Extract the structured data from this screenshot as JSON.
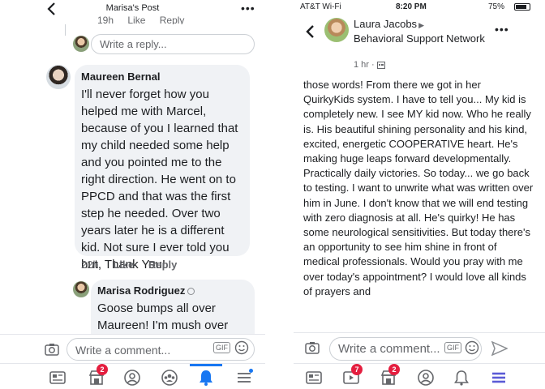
{
  "left": {
    "header": {
      "title": "Marisa's Post"
    },
    "cut_row": {
      "time": "19h",
      "like": "Like",
      "reply": "Reply"
    },
    "reply_placeholder": "Write a reply...",
    "comment1": {
      "author": "Maureen Bernal",
      "text": "I'll never forget how you helped me with Marcel, because of you I learned that my child needed some help and you pointed me to the right direction. He went on to PPCD and that was the first step he needed. Over two years later he is a different kid. Not sure I ever told you but, Thank You!",
      "time": "22h",
      "like": "Like",
      "reply": "Reply"
    },
    "comment2": {
      "author": "Marisa Rodriguez",
      "text": "Goose bumps all over Maureen!  I'm mush over"
    },
    "composer": {
      "placeholder": "Write a comment...",
      "gif": "GIF"
    },
    "tabs": {
      "marketplace_badge": "2"
    }
  },
  "right": {
    "status": {
      "carrier": "AT&T Wi-Fi",
      "time": "8:20 PM",
      "battery": "75%"
    },
    "header": {
      "name": "Laura Jacobs",
      "group": "Behavioral Support Network",
      "time": "1 hr ·"
    },
    "post_text": "those words! From there we got in her QuirkyKids system. I have to tell you... My kid is completely new. I see MY kid now. Who he really is. His beautiful shining personality and his kind, excited, energetic COOPERATIVE heart. He's making huge leaps forward developmentally. Practically daily victories. So today... we go back to testing. I want to unwrite what was written over him in June. I don't know that we will end testing with zero diagnosis at all. He's quirky! He has some neurological sensitivities. But today there's an opportunity to see him shine in front of medical professionals. Would you pray with me over today's appointment? I would love all kinds of prayers and",
    "composer": {
      "placeholder": "Write a comment...",
      "gif": "GIF"
    },
    "tabs": {
      "watch_badge": "7",
      "marketplace_badge": "2"
    }
  },
  "colors": {
    "accent": "#1877f2",
    "badge": "#e41e3f",
    "bubble": "#f0f2f5"
  }
}
